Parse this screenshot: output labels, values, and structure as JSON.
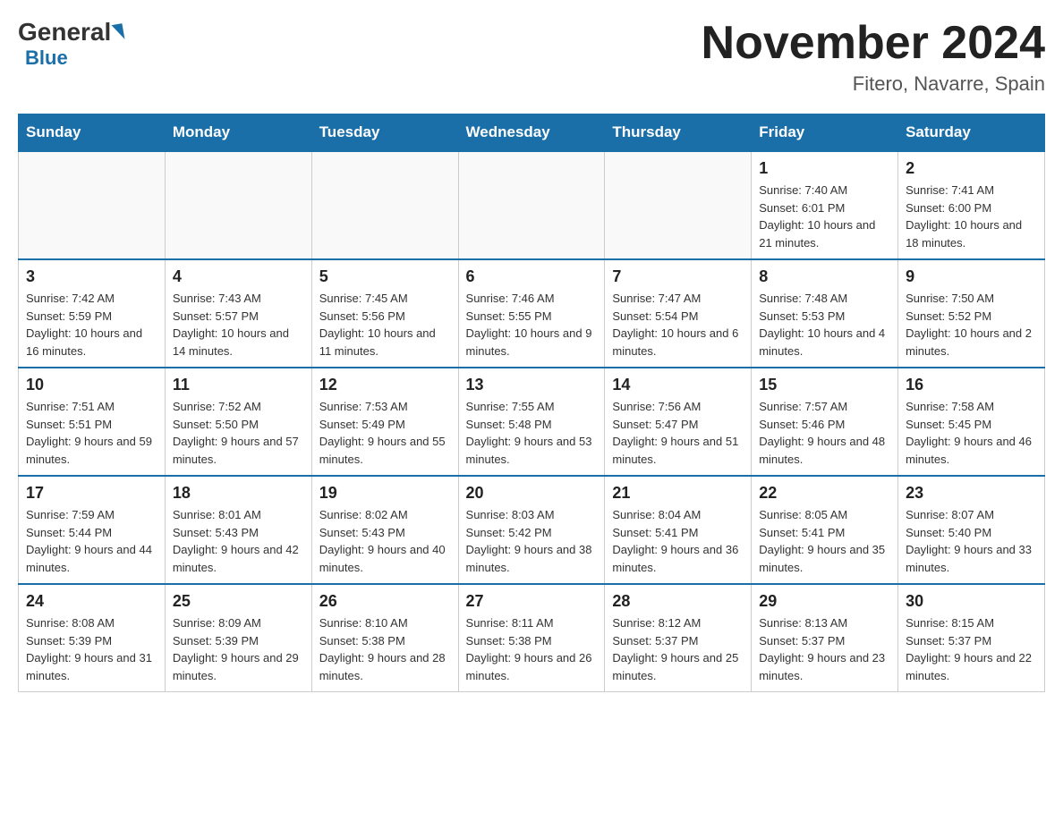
{
  "header": {
    "logo_general": "General",
    "logo_blue": "Blue",
    "title": "November 2024",
    "subtitle": "Fitero, Navarre, Spain"
  },
  "days_of_week": [
    "Sunday",
    "Monday",
    "Tuesday",
    "Wednesday",
    "Thursday",
    "Friday",
    "Saturday"
  ],
  "weeks": [
    [
      {
        "day": "",
        "info": ""
      },
      {
        "day": "",
        "info": ""
      },
      {
        "day": "",
        "info": ""
      },
      {
        "day": "",
        "info": ""
      },
      {
        "day": "",
        "info": ""
      },
      {
        "day": "1",
        "info": "Sunrise: 7:40 AM\nSunset: 6:01 PM\nDaylight: 10 hours and 21 minutes."
      },
      {
        "day": "2",
        "info": "Sunrise: 7:41 AM\nSunset: 6:00 PM\nDaylight: 10 hours and 18 minutes."
      }
    ],
    [
      {
        "day": "3",
        "info": "Sunrise: 7:42 AM\nSunset: 5:59 PM\nDaylight: 10 hours and 16 minutes."
      },
      {
        "day": "4",
        "info": "Sunrise: 7:43 AM\nSunset: 5:57 PM\nDaylight: 10 hours and 14 minutes."
      },
      {
        "day": "5",
        "info": "Sunrise: 7:45 AM\nSunset: 5:56 PM\nDaylight: 10 hours and 11 minutes."
      },
      {
        "day": "6",
        "info": "Sunrise: 7:46 AM\nSunset: 5:55 PM\nDaylight: 10 hours and 9 minutes."
      },
      {
        "day": "7",
        "info": "Sunrise: 7:47 AM\nSunset: 5:54 PM\nDaylight: 10 hours and 6 minutes."
      },
      {
        "day": "8",
        "info": "Sunrise: 7:48 AM\nSunset: 5:53 PM\nDaylight: 10 hours and 4 minutes."
      },
      {
        "day": "9",
        "info": "Sunrise: 7:50 AM\nSunset: 5:52 PM\nDaylight: 10 hours and 2 minutes."
      }
    ],
    [
      {
        "day": "10",
        "info": "Sunrise: 7:51 AM\nSunset: 5:51 PM\nDaylight: 9 hours and 59 minutes."
      },
      {
        "day": "11",
        "info": "Sunrise: 7:52 AM\nSunset: 5:50 PM\nDaylight: 9 hours and 57 minutes."
      },
      {
        "day": "12",
        "info": "Sunrise: 7:53 AM\nSunset: 5:49 PM\nDaylight: 9 hours and 55 minutes."
      },
      {
        "day": "13",
        "info": "Sunrise: 7:55 AM\nSunset: 5:48 PM\nDaylight: 9 hours and 53 minutes."
      },
      {
        "day": "14",
        "info": "Sunrise: 7:56 AM\nSunset: 5:47 PM\nDaylight: 9 hours and 51 minutes."
      },
      {
        "day": "15",
        "info": "Sunrise: 7:57 AM\nSunset: 5:46 PM\nDaylight: 9 hours and 48 minutes."
      },
      {
        "day": "16",
        "info": "Sunrise: 7:58 AM\nSunset: 5:45 PM\nDaylight: 9 hours and 46 minutes."
      }
    ],
    [
      {
        "day": "17",
        "info": "Sunrise: 7:59 AM\nSunset: 5:44 PM\nDaylight: 9 hours and 44 minutes."
      },
      {
        "day": "18",
        "info": "Sunrise: 8:01 AM\nSunset: 5:43 PM\nDaylight: 9 hours and 42 minutes."
      },
      {
        "day": "19",
        "info": "Sunrise: 8:02 AM\nSunset: 5:43 PM\nDaylight: 9 hours and 40 minutes."
      },
      {
        "day": "20",
        "info": "Sunrise: 8:03 AM\nSunset: 5:42 PM\nDaylight: 9 hours and 38 minutes."
      },
      {
        "day": "21",
        "info": "Sunrise: 8:04 AM\nSunset: 5:41 PM\nDaylight: 9 hours and 36 minutes."
      },
      {
        "day": "22",
        "info": "Sunrise: 8:05 AM\nSunset: 5:41 PM\nDaylight: 9 hours and 35 minutes."
      },
      {
        "day": "23",
        "info": "Sunrise: 8:07 AM\nSunset: 5:40 PM\nDaylight: 9 hours and 33 minutes."
      }
    ],
    [
      {
        "day": "24",
        "info": "Sunrise: 8:08 AM\nSunset: 5:39 PM\nDaylight: 9 hours and 31 minutes."
      },
      {
        "day": "25",
        "info": "Sunrise: 8:09 AM\nSunset: 5:39 PM\nDaylight: 9 hours and 29 minutes."
      },
      {
        "day": "26",
        "info": "Sunrise: 8:10 AM\nSunset: 5:38 PM\nDaylight: 9 hours and 28 minutes."
      },
      {
        "day": "27",
        "info": "Sunrise: 8:11 AM\nSunset: 5:38 PM\nDaylight: 9 hours and 26 minutes."
      },
      {
        "day": "28",
        "info": "Sunrise: 8:12 AM\nSunset: 5:37 PM\nDaylight: 9 hours and 25 minutes."
      },
      {
        "day": "29",
        "info": "Sunrise: 8:13 AM\nSunset: 5:37 PM\nDaylight: 9 hours and 23 minutes."
      },
      {
        "day": "30",
        "info": "Sunrise: 8:15 AM\nSunset: 5:37 PM\nDaylight: 9 hours and 22 minutes."
      }
    ]
  ]
}
